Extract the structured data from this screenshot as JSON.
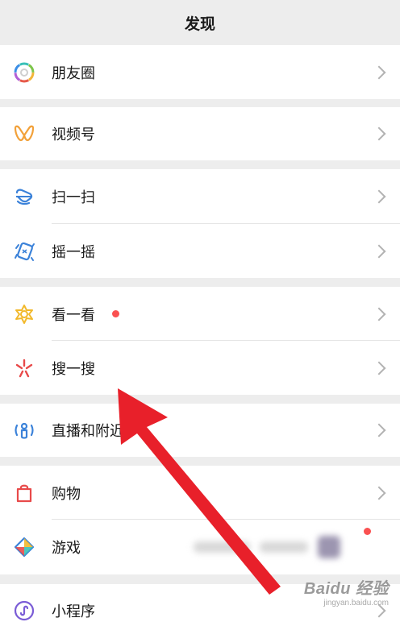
{
  "header": {
    "title": "发现"
  },
  "menu": {
    "moments": {
      "label": "朋友圈",
      "icon": "moments-icon"
    },
    "channels": {
      "label": "视频号",
      "icon": "channels-icon"
    },
    "scan": {
      "label": "扫一扫",
      "icon": "scan-icon"
    },
    "shake": {
      "label": "摇一摇",
      "icon": "shake-icon"
    },
    "top_stories": {
      "label": "看一看",
      "icon": "top-stories-icon",
      "badge": "red-dot"
    },
    "search": {
      "label": "搜一搜",
      "icon": "search-icon"
    },
    "live_nearby": {
      "label": "直播和附近",
      "icon": "live-nearby-icon"
    },
    "shopping": {
      "label": "购物",
      "icon": "shopping-icon"
    },
    "games": {
      "label": "游戏",
      "icon": "games-icon",
      "badge": "red-dot"
    },
    "mini_programs": {
      "label": "小程序",
      "icon": "mini-programs-icon"
    }
  },
  "watermark": {
    "brand": "Baidu 经验",
    "url": "jingyan.baidu.com"
  },
  "colors": {
    "background": "#ededed",
    "row": "#ffffff",
    "badge": "#fa5151",
    "annotation_arrow": "#e8202a"
  }
}
